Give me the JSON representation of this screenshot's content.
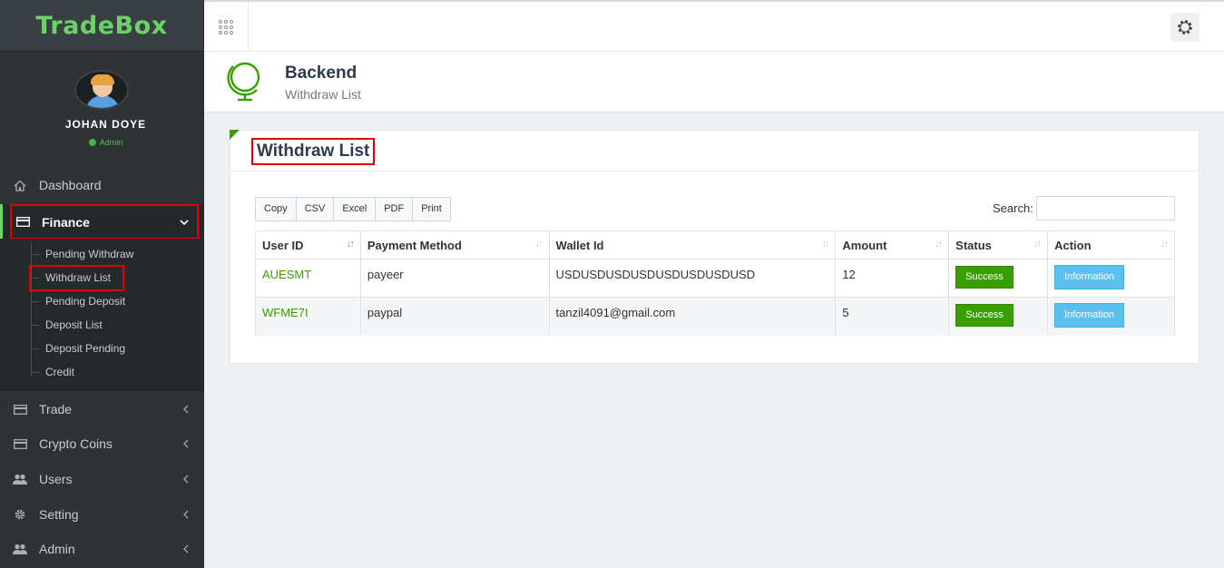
{
  "brand": {
    "name": "TradeBox"
  },
  "user": {
    "name": "JOHAN DOYE",
    "role": "Admin"
  },
  "sidebar": {
    "items": [
      {
        "label": "Dashboard",
        "icon": "home-icon"
      },
      {
        "label": "Finance",
        "icon": "card-icon",
        "expanded": true
      },
      {
        "label": "Trade",
        "icon": "card-icon"
      },
      {
        "label": "Crypto Coins",
        "icon": "card-icon"
      },
      {
        "label": "Users",
        "icon": "users-icon"
      },
      {
        "label": "Setting",
        "icon": "gear-icon"
      },
      {
        "label": "Admin",
        "icon": "users-icon"
      }
    ],
    "finance_sub": [
      {
        "label": "Pending Withdraw"
      },
      {
        "label": "Withdraw List",
        "active": true
      },
      {
        "label": "Pending Deposit"
      },
      {
        "label": "Deposit List"
      },
      {
        "label": "Deposit Pending"
      },
      {
        "label": "Credit"
      }
    ]
  },
  "header": {
    "title": "Backend",
    "subtitle": "Withdraw List"
  },
  "panel": {
    "title": "Withdraw List",
    "buttons": [
      "Copy",
      "CSV",
      "Excel",
      "PDF",
      "Print"
    ],
    "search_label": "Search:"
  },
  "table": {
    "columns": [
      "User ID",
      "Payment Method",
      "Wallet Id",
      "Amount",
      "Status",
      "Action"
    ],
    "rows": [
      {
        "user_id": "AUESMT",
        "method": "payeer",
        "wallet": "USDUSDUSDUSDUSDUSDUSDUSD",
        "amount": "12",
        "status": "Success",
        "action": "Information"
      },
      {
        "user_id": "WFME7I",
        "method": "paypal",
        "wallet": "tanzil4091@gmail.com",
        "amount": "5",
        "status": "Success",
        "action": "Information"
      }
    ]
  },
  "colors": {
    "brand_green": "#6dd16a",
    "accent_green": "#37a000",
    "info_blue": "#5bc0f0",
    "highlight_red": "#e00000"
  }
}
